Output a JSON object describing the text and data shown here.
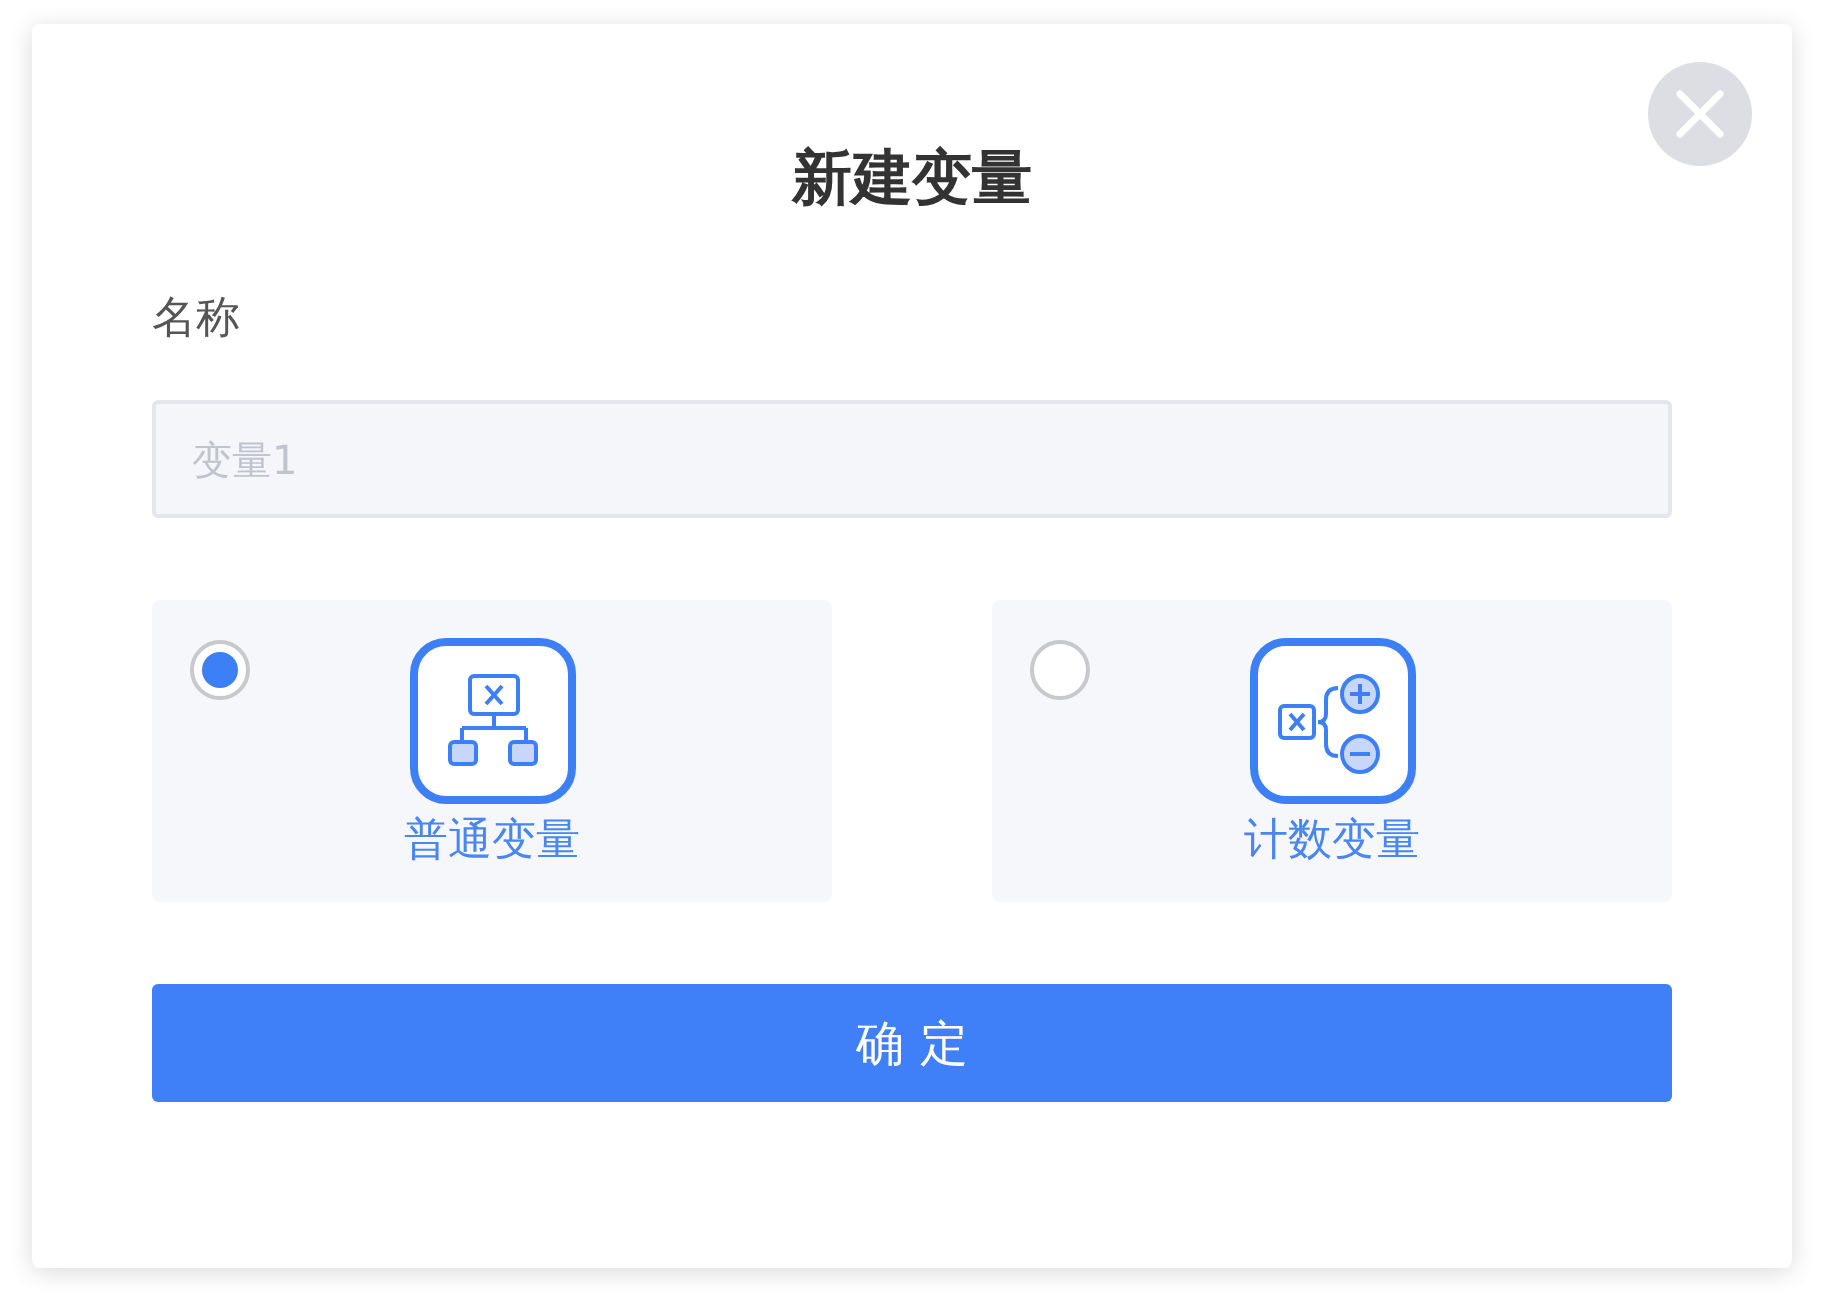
{
  "dialog": {
    "title": "新建变量"
  },
  "name_field": {
    "label": "名称",
    "placeholder": "变量1"
  },
  "variable_types": [
    {
      "label": "普通变量",
      "selected": true,
      "kind": "plain"
    },
    {
      "label": "计数变量",
      "selected": false,
      "kind": "counter"
    }
  ],
  "confirm_button": "确 定"
}
